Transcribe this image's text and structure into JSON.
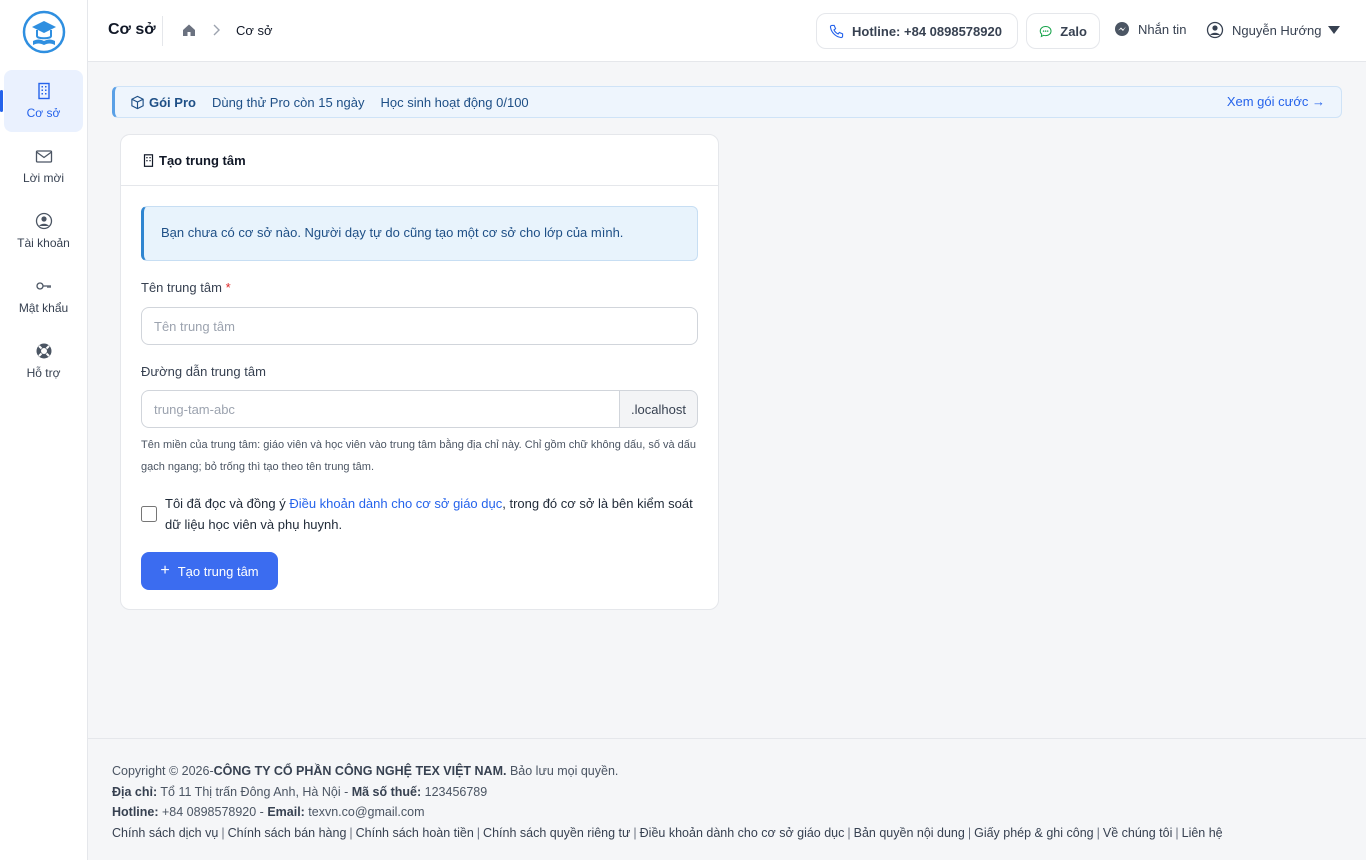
{
  "sidebar": {
    "items": [
      {
        "label": "Cơ sở",
        "icon": "building-icon",
        "active": true
      },
      {
        "label": "Lời mời",
        "icon": "envelope-icon"
      },
      {
        "label": "Tài khoản",
        "icon": "user-circle-icon"
      },
      {
        "label": "Mật khẩu",
        "icon": "key-icon"
      },
      {
        "label": "Hỗ trợ",
        "icon": "lifebuoy-icon"
      }
    ]
  },
  "header": {
    "title": "Cơ sở",
    "breadcrumb_current": "Cơ sở",
    "hotline": "Hotline: +84 0898578920",
    "zalo": "Zalo",
    "message": "Nhắn tin",
    "user_name": "Nguyễn Hướng"
  },
  "banner": {
    "plan": "Gói Pro",
    "trial": "Dùng thử Pro còn 15 ngày",
    "students": "Học sinh hoạt động 0/100",
    "link": "Xem gói cước →"
  },
  "card": {
    "title": "Tạo trung tâm",
    "alert": "Bạn chưa có cơ sở nào. Người dạy tự do cũng tạo một cơ sở cho lớp của mình.",
    "name_label": "Tên trung tâm",
    "name_required": "*",
    "name_placeholder": "Tên trung tâm",
    "slug_label": "Đường dẫn trung tâm",
    "slug_placeholder": "trung-tam-abc",
    "slug_suffix": ".localhost",
    "help": "Tên miền của trung tâm: giáo viên và học viên vào trung tâm bằng địa chỉ này. Chỉ gồm chữ không dấu, số và dấu gạch ngang; bỏ trống thì tạo theo tên trung tâm.",
    "agree_prefix": "Tôi đã đọc và đồng ý ",
    "agree_link": "Điều khoản dành cho cơ sở giáo dục",
    "agree_suffix": ", trong đó cơ sở là bên kiểm soát dữ liệu học viên và phụ huynh.",
    "submit": "Tạo trung tâm"
  },
  "footer": {
    "copyright_prefix": "Copyright © 2026-",
    "company": "CÔNG TY CỔ PHẦN CÔNG NGHỆ TEX VIỆT NAM.",
    "rights": " Bảo lưu mọi quyền.",
    "address_label": "Địa chỉ:",
    "address": " Tổ 11 Thị trấn Đông Anh, Hà Nội - ",
    "tax_label": "Mã số thuế:",
    "tax": " 123456789",
    "hotline_label": "Hotline:",
    "hotline": " +84 0898578920 - ",
    "email_label": "Email:",
    "email": " texvn.co@gmail.com",
    "links": [
      "Chính sách dịch vụ",
      "Chính sách bán hàng",
      "Chính sách hoàn tiền",
      "Chính sách quyền riêng tư",
      "Điều khoản dành cho cơ sở giáo dục",
      "Bản quyền nội dung",
      "Giấy phép & ghi công",
      "Về chúng tôi",
      "Liên hệ"
    ]
  },
  "colors": {
    "accent": "#2563eb",
    "button": "#3b6cf0",
    "alert_bg": "#e8f3fc"
  }
}
